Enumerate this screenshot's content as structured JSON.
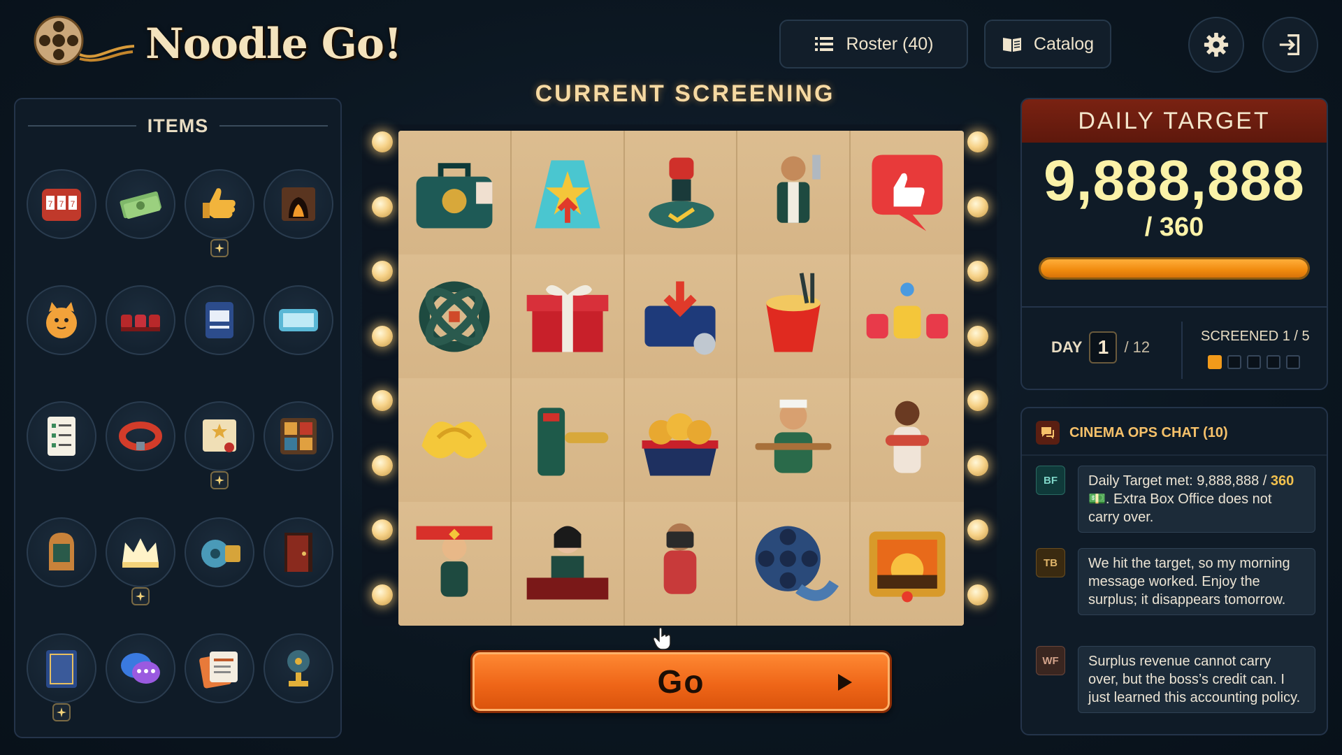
{
  "app": {
    "title": "Noodle Go!"
  },
  "header": {
    "roster_label": "Roster (40)",
    "catalog_label": "Catalog",
    "icons": {
      "roster": "list-icon",
      "catalog": "book-icon",
      "settings": "gear-icon",
      "exit": "exit-icon"
    }
  },
  "items": {
    "heading": "ITEMS",
    "slots": [
      "slot-machine",
      "cash-stack",
      "thumbs-up",
      "fireplace",
      "lucky-cat",
      "theater-seats",
      "vip-pass",
      "screen-panel",
      "checklist",
      "red-collar",
      "certificate",
      "ticket-board",
      "jukebox",
      "glowing-crown",
      "film-tape",
      "red-door",
      "script-book",
      "chat-bubbles",
      "coupons",
      "trophy-reel"
    ],
    "upgraded_slots": [
      2,
      10,
      13,
      16
    ]
  },
  "screening": {
    "title": "CURRENT SCREENING",
    "cells": [
      "briefcase",
      "star-spotlight",
      "approval-stamp",
      "bartender",
      "like-bubble",
      "film-knot",
      "gift-box",
      "inbox-folder",
      "noodle-cup",
      "vip-seats",
      "butter-ribbon",
      "ticket-turnstile",
      "nugget-basket",
      "baker-lady",
      "hugging-woman",
      "fan-scarf",
      "box-office-clerk",
      "photographer",
      "film-reel",
      "sunset-poster"
    ],
    "go_label": "Go"
  },
  "daily_target": {
    "heading": "DAILY TARGET",
    "value": "9,888,888",
    "sub": "/  360",
    "progress": 1.0,
    "day_label": "DAY",
    "day": "1",
    "day_total": "/ 12",
    "screened_label": "SCREENED 1 / 5",
    "screened": 1,
    "screened_max": 5
  },
  "chat": {
    "title": "CINEMA OPS CHAT (10)",
    "messages": [
      {
        "initials": "BF",
        "pre": "Daily Target met: 9,888,888 / ",
        "hl": "360",
        "post": " 💵. Extra Box Office does not carry over."
      },
      {
        "initials": "TB",
        "text": "We hit the target, so my morning message worked. Enjoy the surplus; it disappears tomorrow."
      },
      {
        "initials": "WF",
        "text": "Surplus revenue cannot carry over, but the boss’s credit can. I just learned this accounting policy."
      }
    ]
  },
  "colors": {
    "accent": "#ef6618",
    "gold": "#fbf2a8",
    "panel": "#0f1b27",
    "target_header": "#6e1e10"
  }
}
